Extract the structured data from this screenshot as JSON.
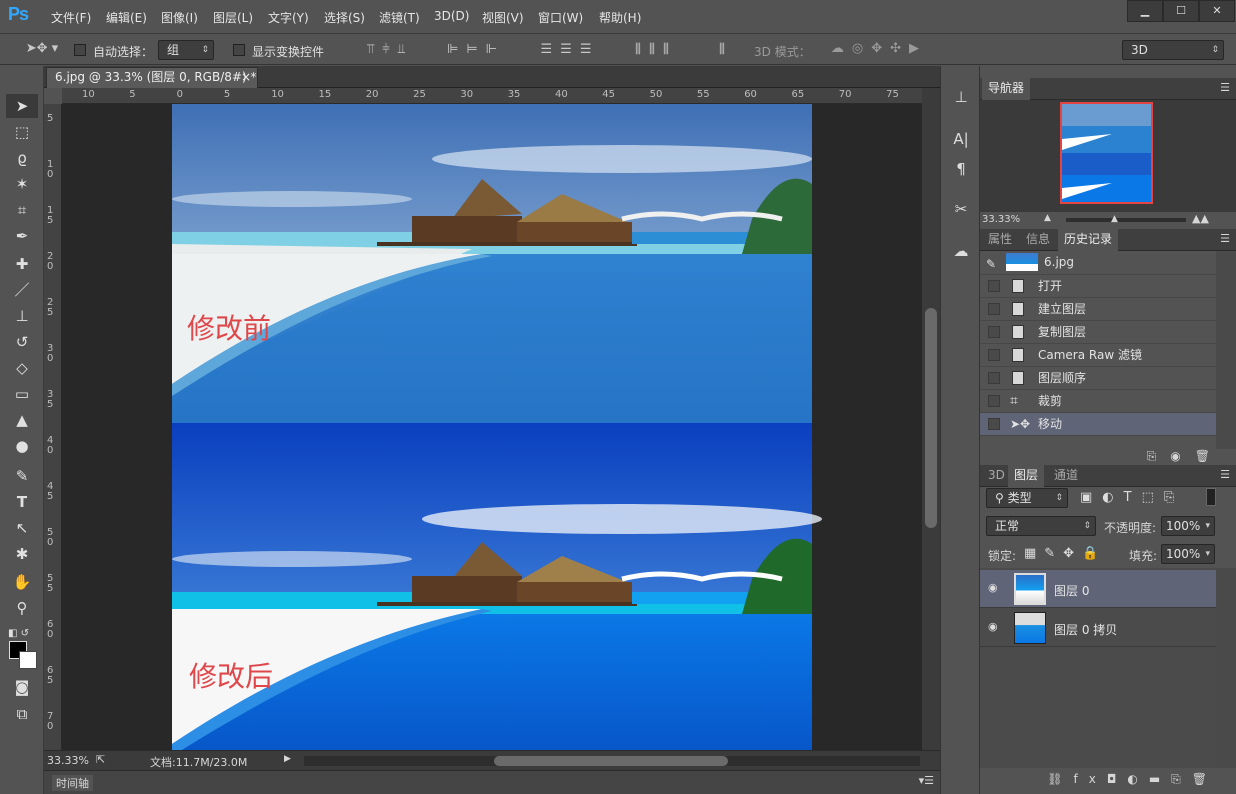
{
  "app": {
    "logo": "Ps"
  },
  "menus": [
    "文件(F)",
    "编辑(E)",
    "图像(I)",
    "图层(L)",
    "文字(Y)",
    "选择(S)",
    "滤镜(T)",
    "3D(D)",
    "视图(V)",
    "窗口(W)",
    "帮助(H)"
  ],
  "window_controls": [
    "▁",
    "☐",
    "✕"
  ],
  "options": {
    "auto_select_label": "自动选择：",
    "auto_select_value": "组",
    "show_transform_label": "显示变换控件",
    "mode_3d_label": "3D 模式：",
    "workspace_value": "3D"
  },
  "document": {
    "tab_title": "6.jpg @ 33.3% (图层 0, RGB/8#) *",
    "close": "×",
    "label_before": "修改前",
    "label_after": "修改后",
    "zoom": "33.33%",
    "doc_size": "文档:11.7M/23.0M"
  },
  "ruler": {
    "h": [
      "10",
      "5",
      "0",
      "5",
      "10",
      "15",
      "20",
      "25",
      "30",
      "35",
      "40",
      "45",
      "50",
      "55",
      "60",
      "65",
      "70",
      "75"
    ],
    "v": [
      "5",
      "1 0",
      "1 5",
      "2 0",
      "2 5",
      "3 0",
      "3 5",
      "4 0",
      "4 5",
      "5 0",
      "5 5",
      "6 0",
      "6 5",
      "7 0"
    ]
  },
  "timeline": {
    "label": "时间轴"
  },
  "navigator": {
    "tab": "导航器",
    "zoom": "33.33%"
  },
  "history_panel": {
    "tabs": [
      "属性",
      "信息",
      "历史记录"
    ],
    "snapshot": "6.jpg",
    "steps": [
      "打开",
      "建立图层",
      "复制图层",
      "Camera Raw 滤镜",
      "图层顺序",
      "裁剪",
      "移动"
    ]
  },
  "layers_panel": {
    "tabs": [
      "3D",
      "图层",
      "通道"
    ],
    "filter": "类型",
    "blend_mode": "正常",
    "opacity_label": "不透明度:",
    "opacity_value": "100%",
    "lock_label": "锁定:",
    "fill_label": "填充:",
    "fill_value": "100%",
    "layers": [
      {
        "name": "图层 0"
      },
      {
        "name": "图层 0 拷贝"
      }
    ]
  },
  "colors": {
    "accent": "#31a8ff",
    "before_text": "#e0474a",
    "after_text": "#e0474a"
  }
}
